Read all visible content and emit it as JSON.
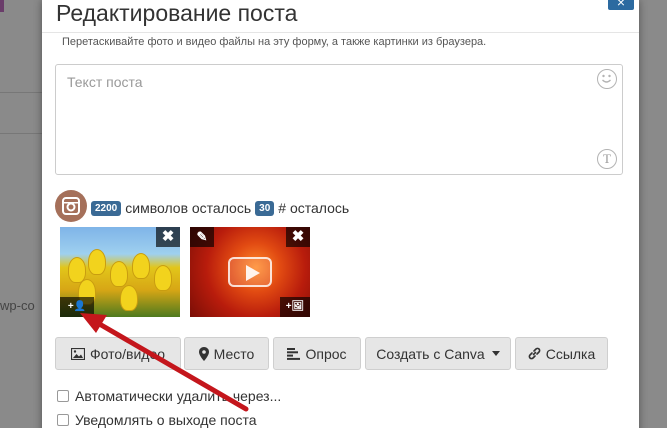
{
  "background": {
    "partial_text": "wp-co"
  },
  "modal": {
    "title": "Редактирование поста",
    "close_glyph": "×",
    "hint": "Перетаскивайте фото и видео файлы на эту форму, а также картинки из браузера.",
    "textarea": {
      "placeholder": "Текст поста",
      "emoji_icon": "smiley-icon",
      "format_icon": "text-format-icon",
      "format_glyph": "T"
    },
    "counter": {
      "chars_left": "2200",
      "chars_label": "символов осталось",
      "hashtags_left": "30",
      "hashtags_label": "# осталось"
    },
    "media": [
      {
        "kind": "image",
        "icon_remove": "✖",
        "icon_tag": "+👤"
      },
      {
        "kind": "video",
        "icon_edit": "✎",
        "icon_remove": "✖",
        "icon_add_image": "+🖼"
      }
    ],
    "buttons": {
      "photo": "Фото/видео",
      "place": "Место",
      "poll": "Опрос",
      "canva": "Создать с Canva",
      "link": "Ссылка"
    },
    "checkboxes": {
      "auto_delete": "Автоматически удалить через...",
      "notify": "Уведомлять о выходе поста"
    }
  },
  "colors": {
    "accent": "#2c6aa0",
    "badge": "#3a6a95",
    "annotation_arrow": "#c4161c"
  }
}
